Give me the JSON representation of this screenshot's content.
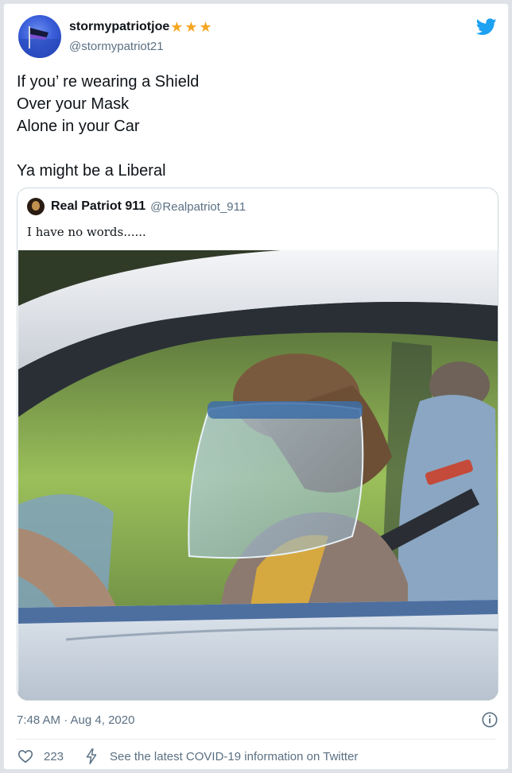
{
  "author": {
    "display_name": "stormypatriotjoe",
    "handle": "@stormypatriot21",
    "badges": [
      "star",
      "star",
      "star"
    ],
    "avatar_icon": "flag-avatar-icon"
  },
  "tweet": {
    "lines": [
      "If you’ re wearing a Shield",
      "Over your Mask",
      "Alone in your Car"
    ],
    "closing_line": "Ya might be a Liberal"
  },
  "quoted_tweet": {
    "display_name": "Real Patriot 911",
    "handle": "@Realpatriot_911",
    "text": "I have no words......",
    "photo_subject": "person-in-car-with-face-shield"
  },
  "meta": {
    "timestamp": "7:48 AM · Aug 4, 2020"
  },
  "footer": {
    "likes": "223",
    "covid_link": "See the latest COVID-19 information on Twitter"
  },
  "colors": {
    "twitter_blue": "#1da1f2",
    "star": "#f5a623",
    "secondary_text": "#5b7083",
    "border": "#cfd9de"
  }
}
